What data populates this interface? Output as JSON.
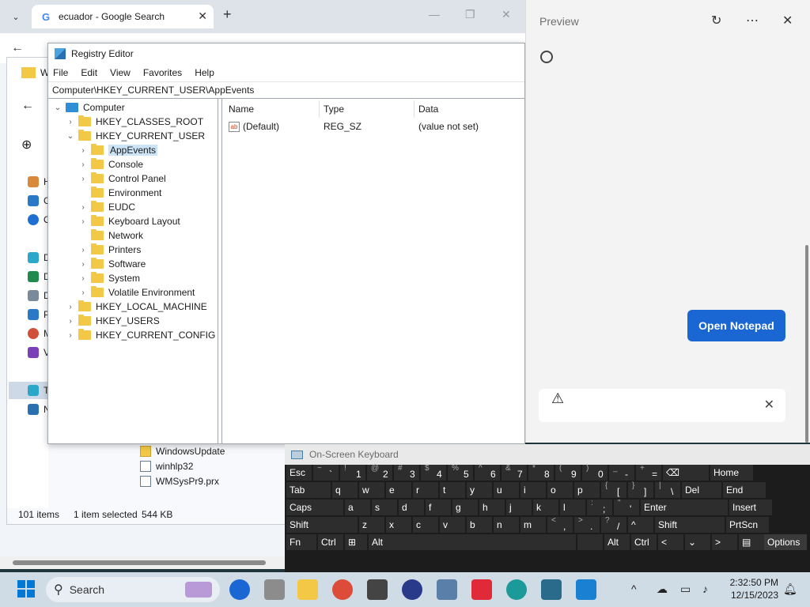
{
  "chrome": {
    "tab_title": "ecuador - Google Search",
    "tab_close": "✕",
    "new_tab": "+",
    "google_letter": "G"
  },
  "explorer": {
    "sidebar_letters": [
      "H",
      "G",
      "O",
      "D",
      "D",
      "D",
      "P",
      "M",
      "V",
      "T",
      "N"
    ],
    "files": [
      "WindowsUpdate",
      "winhlp32",
      "WMSysPr9.prx"
    ],
    "status_items": "101 items",
    "status_selected": "1 item selected",
    "status_size": "544 KB",
    "toolbar_new": "⊕",
    "toolbar_letter": "W"
  },
  "regedit": {
    "title": "Registry Editor",
    "menu": [
      "File",
      "Edit",
      "View",
      "Favorites",
      "Help"
    ],
    "address": "Computer\\HKEY_CURRENT_USER\\AppEvents",
    "tree": {
      "root": "Computer",
      "hives": [
        "HKEY_CLASSES_ROOT",
        "HKEY_CURRENT_USER",
        "HKEY_LOCAL_MACHINE",
        "HKEY_USERS",
        "HKEY_CURRENT_CONFIG"
      ],
      "hkcu_children": [
        "AppEvents",
        "Console",
        "Control Panel",
        "Environment",
        "EUDC",
        "Keyboard Layout",
        "Network",
        "Printers",
        "Software",
        "System",
        "Volatile Environment"
      ]
    },
    "columns": [
      "Name",
      "Type",
      "Data"
    ],
    "values": [
      {
        "name": "(Default)",
        "type": "REG_SZ",
        "data": "(value not set)"
      }
    ],
    "ab_icon": "ab"
  },
  "preview": {
    "title": "Preview",
    "open_notepad": "Open Notepad"
  },
  "osk": {
    "title": "On-Screen Keyboard",
    "rows": [
      [
        [
          "",
          "Esc"
        ],
        [
          "~",
          "`"
        ],
        [
          "!",
          "1"
        ],
        [
          "@",
          "2"
        ],
        [
          "#",
          "3"
        ],
        [
          "$",
          "4"
        ],
        [
          "%",
          "5"
        ],
        [
          "^",
          "6"
        ],
        [
          "&",
          "7"
        ],
        [
          "*",
          "8"
        ],
        [
          "(",
          "9"
        ],
        [
          ")",
          "0"
        ],
        [
          "_",
          "-"
        ],
        [
          "+",
          "="
        ],
        [
          "",
          "⌫"
        ],
        [
          "",
          "Home"
        ]
      ],
      [
        [
          "",
          "Tab"
        ],
        [
          "",
          "q"
        ],
        [
          "",
          "w"
        ],
        [
          "",
          "e"
        ],
        [
          "",
          "r"
        ],
        [
          "",
          "t"
        ],
        [
          "",
          "y"
        ],
        [
          "",
          "u"
        ],
        [
          "",
          "i"
        ],
        [
          "",
          "o"
        ],
        [
          "",
          "p"
        ],
        [
          "{",
          "["
        ],
        [
          "}",
          "]"
        ],
        [
          "|",
          "\\"
        ],
        [
          "",
          "Del"
        ],
        [
          "",
          "End"
        ]
      ],
      [
        [
          "",
          "Caps"
        ],
        [
          "",
          "a"
        ],
        [
          "",
          "s"
        ],
        [
          "",
          "d"
        ],
        [
          "",
          "f"
        ],
        [
          "",
          "g"
        ],
        [
          "",
          "h"
        ],
        [
          "",
          "j"
        ],
        [
          "",
          "k"
        ],
        [
          "",
          "l"
        ],
        [
          ":",
          ";"
        ],
        [
          "\"",
          "'"
        ],
        [
          "",
          "Enter"
        ],
        [
          "",
          "Insert"
        ]
      ],
      [
        [
          "",
          "Shift"
        ],
        [
          "",
          "z"
        ],
        [
          "",
          "x"
        ],
        [
          "",
          "c"
        ],
        [
          "",
          "v"
        ],
        [
          "",
          "b"
        ],
        [
          "",
          "n"
        ],
        [
          "",
          "m"
        ],
        [
          "<",
          ","
        ],
        [
          ">",
          "."
        ],
        [
          "?",
          "/"
        ],
        [
          "",
          "^"
        ],
        [
          "",
          "Shift"
        ],
        [
          "",
          "PrtScn"
        ]
      ],
      [
        [
          "",
          "Fn"
        ],
        [
          "",
          "Ctrl"
        ],
        [
          "",
          "⊞"
        ],
        [
          "",
          "Alt"
        ],
        [
          "",
          ""
        ],
        [
          "",
          "Alt"
        ],
        [
          "",
          "Ctrl"
        ],
        [
          "",
          "<"
        ],
        [
          "",
          "⌄"
        ],
        [
          "",
          ">"
        ],
        [
          "",
          "▤"
        ],
        [
          "",
          "Options"
        ]
      ]
    ]
  },
  "taskbar": {
    "search": "Search",
    "time": "2:32:50 PM",
    "date": "12/15/2023"
  },
  "colors": {
    "accent": "#1a66d2",
    "selection": "#cce4f7",
    "folder": "#f3c846"
  }
}
